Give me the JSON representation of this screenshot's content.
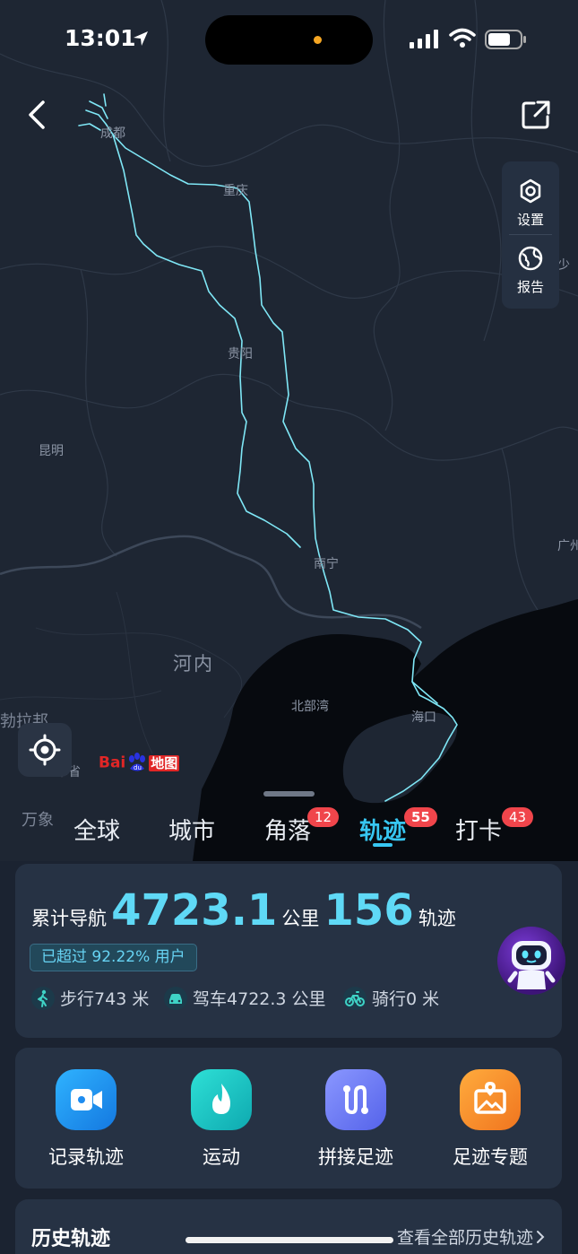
{
  "status_bar": {
    "time": "13:01"
  },
  "map": {
    "labels": {
      "chengdu": "成都",
      "chongqing": "重庆",
      "guiyang": "贵阳",
      "kunming": "昆明",
      "nanning": "南宁",
      "hanoi": "河内",
      "gulf": "北部湾",
      "haikou": "海口",
      "guangzhou": "广州",
      "vientiane": "万象",
      "luang_prabang": "勃拉邦",
      "province": "本省",
      "edge_sha": "少"
    },
    "side_panel": {
      "settings": "设置",
      "report": "报告"
    },
    "logo": {
      "brand": "Bai",
      "suffix": "地图"
    }
  },
  "tabs": [
    {
      "label": "全球",
      "badge": ""
    },
    {
      "label": "城市",
      "badge": ""
    },
    {
      "label": "角落",
      "badge": "12"
    },
    {
      "label": "轨迹",
      "badge": "55",
      "active": true
    },
    {
      "label": "打卡",
      "badge": "43"
    }
  ],
  "stats": {
    "nav_label": "累计导航",
    "distance": "4723.1",
    "distance_unit": "公里",
    "track_count": "156",
    "track_unit": "轨迹",
    "exceed": "已超过 92.22% 用户",
    "modes": [
      {
        "name": "步行",
        "value": "743 米",
        "icon": "walk-icon"
      },
      {
        "name": "驾车",
        "value": "4722.3 公里",
        "icon": "car-icon"
      },
      {
        "name": "骑行",
        "value": "0 米",
        "icon": "bike-icon"
      }
    ]
  },
  "actions": [
    {
      "label": "记录轨迹",
      "icon": "video-record-icon",
      "color": "#1e9bf0"
    },
    {
      "label": "运动",
      "icon": "flame-icon",
      "color": "#16c3c0"
    },
    {
      "label": "拼接足迹",
      "icon": "route-connect-icon",
      "color": "#6b7cf5"
    },
    {
      "label": "足迹专题",
      "icon": "map-photo-icon",
      "color": "#f5922a"
    }
  ],
  "history": {
    "title": "历史轨迹",
    "link": "查看全部历史轨迹"
  }
}
